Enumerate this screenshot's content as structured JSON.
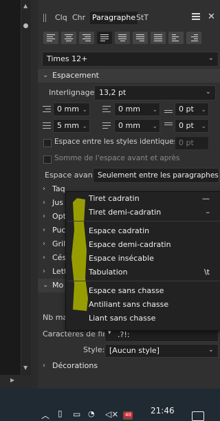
{
  "tabs": [
    {
      "label": "Clq"
    },
    {
      "label": "Chr"
    },
    {
      "label": "Paragraphe"
    },
    {
      "label": "StT"
    }
  ],
  "font": {
    "value": "Times 12+"
  },
  "espacement": {
    "title": "Espacement",
    "interligne_label": "Interlignage:",
    "interligne_value": "13,2 pt",
    "row1": [
      "0 mm",
      "0 mm",
      "0 pt"
    ],
    "row2": [
      "5 mm",
      "0 mm",
      "0 pt"
    ],
    "check1_label": "Espace entre les styles identiques:",
    "check1_value": "0 pt",
    "check2_label": "Somme de l'espace avant et après",
    "espace_avant_label": "Espace avant:",
    "espace_avant_value": "Seulement entre les paragraphes"
  },
  "collapsed_sections": [
    "Taq",
    "Jus",
    "Opt",
    "Puc",
    "Gril",
    "Césu",
    "Lett",
    "Mo"
  ],
  "partial_rows": {
    "nb_ma": "Nb ma",
    "caracteres_label": "Caractères de fin:",
    "caracteres_value": ".?!:",
    "style_label": "Style:",
    "style_value": "[Aucun style]",
    "decorations": "Décorations"
  },
  "menu": {
    "items": [
      {
        "label": "Tiret cadratin",
        "shortcut": "—"
      },
      {
        "label": "Tiret demi-cadratin",
        "shortcut": "–"
      },
      {
        "label": "Espace cadratin",
        "shortcut": ""
      },
      {
        "label": "Espace demi-cadratin",
        "shortcut": ""
      },
      {
        "label": "Espace insécable",
        "shortcut": ""
      },
      {
        "label": "Tabulation",
        "shortcut": "\\t"
      },
      {
        "label": "Espace sans chasse",
        "shortcut": ""
      },
      {
        "label": "Antiliant sans chasse",
        "shortcut": ""
      },
      {
        "label": "Liant sans chasse",
        "shortcut": ""
      }
    ]
  },
  "taskbar": {
    "time": "21:46",
    "badge": "40"
  },
  "colors": {
    "highlight": "#9ea400",
    "panel": "#303030",
    "field": "#1f1f1f"
  }
}
